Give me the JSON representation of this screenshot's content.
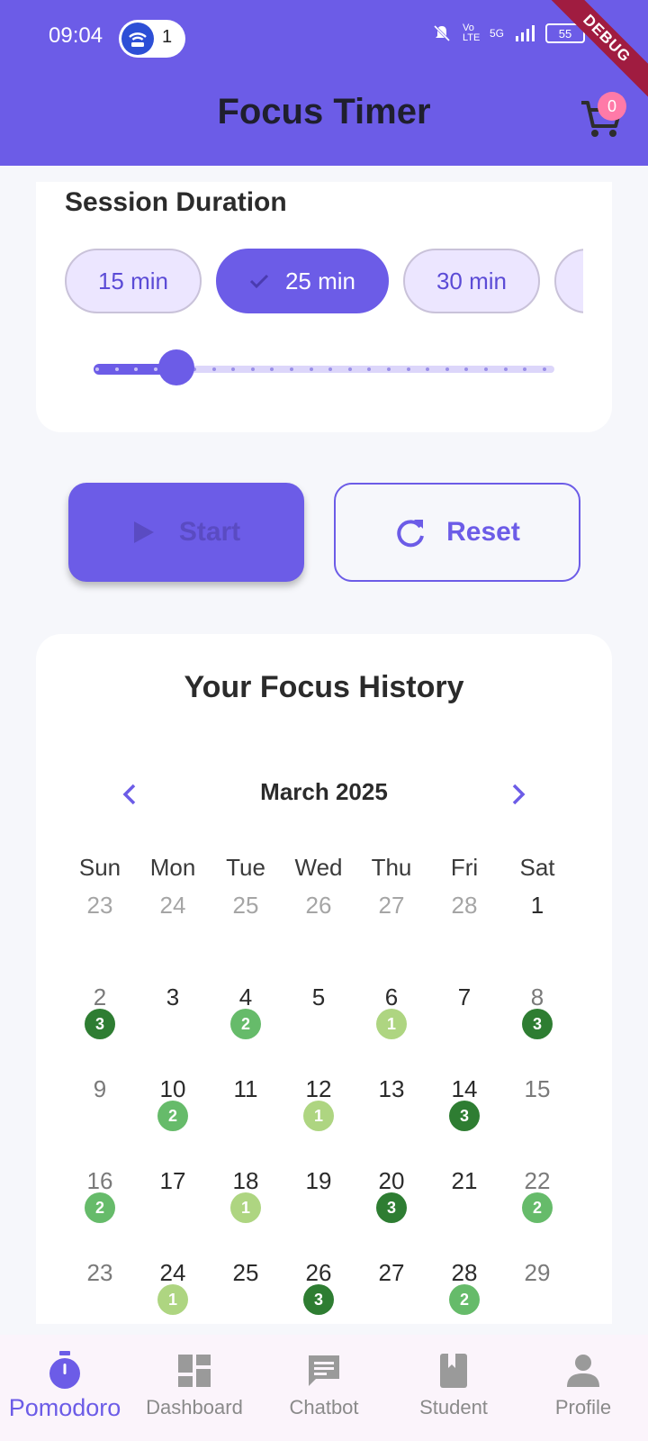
{
  "status_bar": {
    "time": "09:04",
    "hotspot_count": "1",
    "network_labels": [
      "Vo LTE",
      "5G"
    ],
    "battery": "55"
  },
  "debug_banner": "DEBUG",
  "header": {
    "title": "Focus Timer",
    "cart_icon": "cart-icon",
    "cart_count": "0"
  },
  "session": {
    "title": "Session Duration",
    "chips": [
      {
        "label": "15 min",
        "selected": false
      },
      {
        "label": "25 min",
        "selected": true
      },
      {
        "label": "30 min",
        "selected": false
      }
    ],
    "slider": {
      "value_fraction": 0.18
    }
  },
  "controls": {
    "start_label": "Start",
    "reset_label": "Reset"
  },
  "history": {
    "title": "Your Focus History",
    "month": "March 2025",
    "weekdays": [
      "Sun",
      "Mon",
      "Tue",
      "Wed",
      "Thu",
      "Fri",
      "Sat"
    ],
    "weeks": [
      [
        {
          "d": "23",
          "muted": true
        },
        {
          "d": "24",
          "muted": true
        },
        {
          "d": "25",
          "muted": true
        },
        {
          "d": "26",
          "muted": true
        },
        {
          "d": "27",
          "muted": true
        },
        {
          "d": "28",
          "muted": true
        },
        {
          "d": "1"
        }
      ],
      [
        {
          "d": "2",
          "badge": "3"
        },
        {
          "d": "3"
        },
        {
          "d": "4",
          "badge": "2"
        },
        {
          "d": "5"
        },
        {
          "d": "6",
          "badge": "1"
        },
        {
          "d": "7"
        },
        {
          "d": "8",
          "badge": "3"
        }
      ],
      [
        {
          "d": "9"
        },
        {
          "d": "10",
          "badge": "2"
        },
        {
          "d": "11"
        },
        {
          "d": "12",
          "badge": "1"
        },
        {
          "d": "13"
        },
        {
          "d": "14",
          "badge": "3"
        },
        {
          "d": "15"
        }
      ],
      [
        {
          "d": "16",
          "badge": "2"
        },
        {
          "d": "17"
        },
        {
          "d": "18",
          "badge": "1"
        },
        {
          "d": "19"
        },
        {
          "d": "20",
          "badge": "3"
        },
        {
          "d": "21"
        },
        {
          "d": "22",
          "badge": "2"
        }
      ],
      [
        {
          "d": "23"
        },
        {
          "d": "24",
          "badge": "1"
        },
        {
          "d": "25"
        },
        {
          "d": "26",
          "badge": "3"
        },
        {
          "d": "27"
        },
        {
          "d": "28",
          "badge": "2"
        },
        {
          "d": "29"
        }
      ]
    ],
    "badge_colors": {
      "1": "#aed581",
      "2": "#66bb6a",
      "3": "#2e7d32"
    }
  },
  "nav": {
    "items": [
      {
        "label": "Pomodoro",
        "icon": "timer-icon",
        "active": true
      },
      {
        "label": "Dashboard",
        "icon": "dashboard-icon",
        "active": false
      },
      {
        "label": "Chatbot",
        "icon": "chat-icon",
        "active": false
      },
      {
        "label": "Student",
        "icon": "book-icon",
        "active": false
      },
      {
        "label": "Profile",
        "icon": "person-icon",
        "active": false
      }
    ]
  },
  "colors": {
    "primary": "#6c5ce7",
    "debug": "#a01c40",
    "badge": "#ff7aa8"
  }
}
